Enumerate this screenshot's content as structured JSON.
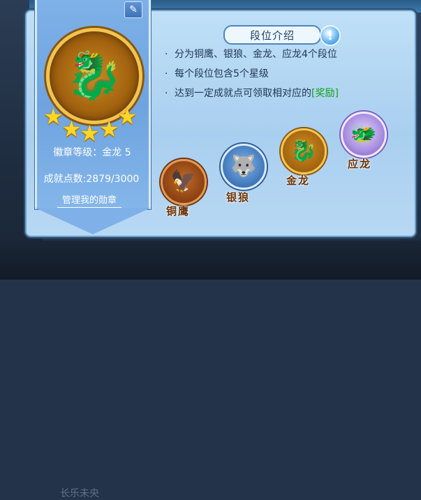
{
  "background": {
    "bottom_text": "长乐未央"
  },
  "badge_card": {
    "current_medal_icon": "gold-dragon-medal-icon",
    "stars": [
      "★",
      "★",
      "★",
      "★",
      "★"
    ],
    "level_text": "徽章等级：金龙 5",
    "points_text": "成就点数:2879/3000",
    "manage_link": "管理我的勋章",
    "edit_icon": "✎"
  },
  "rank_info": {
    "title": "段位介绍",
    "info_icon": "!",
    "bullets": [
      {
        "dot": "·",
        "text": "分为铜鹰、银狼、金龙、应龙4个段位"
      },
      {
        "dot": "·",
        "text": "每个段位包含5个星级"
      },
      {
        "dot": "·",
        "text": "达到一定成就点可领取相对应的",
        "reward": "[奖励]"
      }
    ]
  },
  "ranks": [
    {
      "label": "铜鹰",
      "glyph": "🦅",
      "color": "#c06a2a"
    },
    {
      "label": "银狼",
      "glyph": "🐺",
      "color": "#3f76b8"
    },
    {
      "label": "金龙",
      "glyph": "🐉",
      "color": "#d08d22"
    },
    {
      "label": "应龙",
      "glyph": "🐲",
      "color": "#a88ee0"
    }
  ]
}
